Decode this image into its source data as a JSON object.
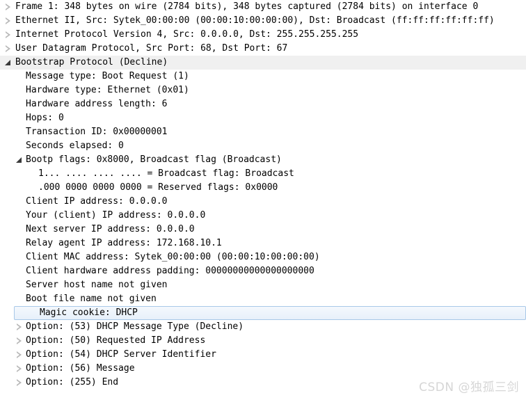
{
  "pane": {
    "name": "packet-details",
    "application": "Wireshark Packet Details"
  },
  "watermark": "CSDN @独孤三剑",
  "rows": [
    {
      "id": "frame",
      "level": 0,
      "state": "collapsed",
      "highlight": "none",
      "text": "Frame 1: 348 bytes on wire (2784 bits), 348 bytes captured (2784 bits) on interface 0"
    },
    {
      "id": "ethernet",
      "level": 0,
      "state": "collapsed",
      "highlight": "none",
      "text": "Ethernet II, Src: Sytek_00:00:00 (00:00:10:00:00:00), Dst: Broadcast (ff:ff:ff:ff:ff:ff)"
    },
    {
      "id": "ipv4",
      "level": 0,
      "state": "collapsed",
      "highlight": "none",
      "text": "Internet Protocol Version 4, Src: 0.0.0.0, Dst: 255.255.255.255"
    },
    {
      "id": "udp",
      "level": 0,
      "state": "collapsed",
      "highlight": "none",
      "text": "User Datagram Protocol, Src Port: 68, Dst Port: 67"
    },
    {
      "id": "bootp",
      "level": 0,
      "state": "expanded",
      "highlight": "band",
      "text": "Bootstrap Protocol (Decline)"
    },
    {
      "id": "message-type",
      "level": 1,
      "state": "leaf",
      "highlight": "none",
      "text": "Message type: Boot Request (1)"
    },
    {
      "id": "hardware-type",
      "level": 1,
      "state": "leaf",
      "highlight": "none",
      "text": "Hardware type: Ethernet (0x01)"
    },
    {
      "id": "hw-addr-len",
      "level": 1,
      "state": "leaf",
      "highlight": "none",
      "text": "Hardware address length: 6"
    },
    {
      "id": "hops",
      "level": 1,
      "state": "leaf",
      "highlight": "none",
      "text": "Hops: 0"
    },
    {
      "id": "transaction-id",
      "level": 1,
      "state": "leaf",
      "highlight": "none",
      "text": "Transaction ID: 0x00000001"
    },
    {
      "id": "seconds-elapsed",
      "level": 1,
      "state": "leaf",
      "highlight": "none",
      "text": "Seconds elapsed: 0"
    },
    {
      "id": "bootp-flags",
      "level": 1,
      "state": "expanded",
      "highlight": "none",
      "text": "Bootp flags: 0x8000, Broadcast flag (Broadcast)"
    },
    {
      "id": "broadcast-flag",
      "level": 2,
      "state": "none",
      "highlight": "none",
      "text": "1... .... .... .... = Broadcast flag: Broadcast"
    },
    {
      "id": "reserved-flags",
      "level": 2,
      "state": "none",
      "highlight": "none",
      "text": ".000 0000 0000 0000 = Reserved flags: 0x0000"
    },
    {
      "id": "client-ip",
      "level": 1,
      "state": "leaf",
      "highlight": "none",
      "text": "Client IP address: 0.0.0.0"
    },
    {
      "id": "your-client-ip",
      "level": 1,
      "state": "leaf",
      "highlight": "none",
      "text": "Your (client) IP address: 0.0.0.0"
    },
    {
      "id": "next-server-ip",
      "level": 1,
      "state": "leaf",
      "highlight": "none",
      "text": "Next server IP address: 0.0.0.0"
    },
    {
      "id": "relay-agent-ip",
      "level": 1,
      "state": "leaf",
      "highlight": "none",
      "text": "Relay agent IP address: 172.168.10.1"
    },
    {
      "id": "client-mac",
      "level": 1,
      "state": "leaf",
      "highlight": "none",
      "text": "Client MAC address: Sytek_00:00:00 (00:00:10:00:00:00)"
    },
    {
      "id": "client-hw-pad",
      "level": 1,
      "state": "leaf",
      "highlight": "none",
      "text": "Client hardware address padding: 00000000000000000000"
    },
    {
      "id": "server-host-name",
      "level": 1,
      "state": "leaf",
      "highlight": "none",
      "text": "Server host name not given"
    },
    {
      "id": "boot-file-name",
      "level": 1,
      "state": "leaf",
      "highlight": "none",
      "text": "Boot file name not given"
    },
    {
      "id": "magic-cookie",
      "level": 1,
      "state": "leaf",
      "highlight": "selected",
      "text": "Magic cookie: DHCP"
    },
    {
      "id": "option-53",
      "level": 1,
      "state": "collapsed",
      "highlight": "none",
      "text": "Option: (53) DHCP Message Type (Decline)"
    },
    {
      "id": "option-50",
      "level": 1,
      "state": "collapsed",
      "highlight": "none",
      "text": "Option: (50) Requested IP Address"
    },
    {
      "id": "option-54",
      "level": 1,
      "state": "collapsed",
      "highlight": "none",
      "text": "Option: (54) DHCP Server Identifier"
    },
    {
      "id": "option-56",
      "level": 1,
      "state": "collapsed",
      "highlight": "none",
      "text": "Option: (56) Message"
    },
    {
      "id": "option-255",
      "level": 1,
      "state": "collapsed",
      "highlight": "none",
      "text": "Option: (255) End"
    }
  ],
  "colors": {
    "background": "#ffffff",
    "text": "#000000",
    "selection_border": "#a8c8e8",
    "selection_fill": "#e7f0fa",
    "focus_band": "#f0f0f0",
    "twisty_collapsed": "#b8b8b8",
    "twisty_expanded": "#3a3a3a",
    "watermark": "#d6d6d6"
  }
}
